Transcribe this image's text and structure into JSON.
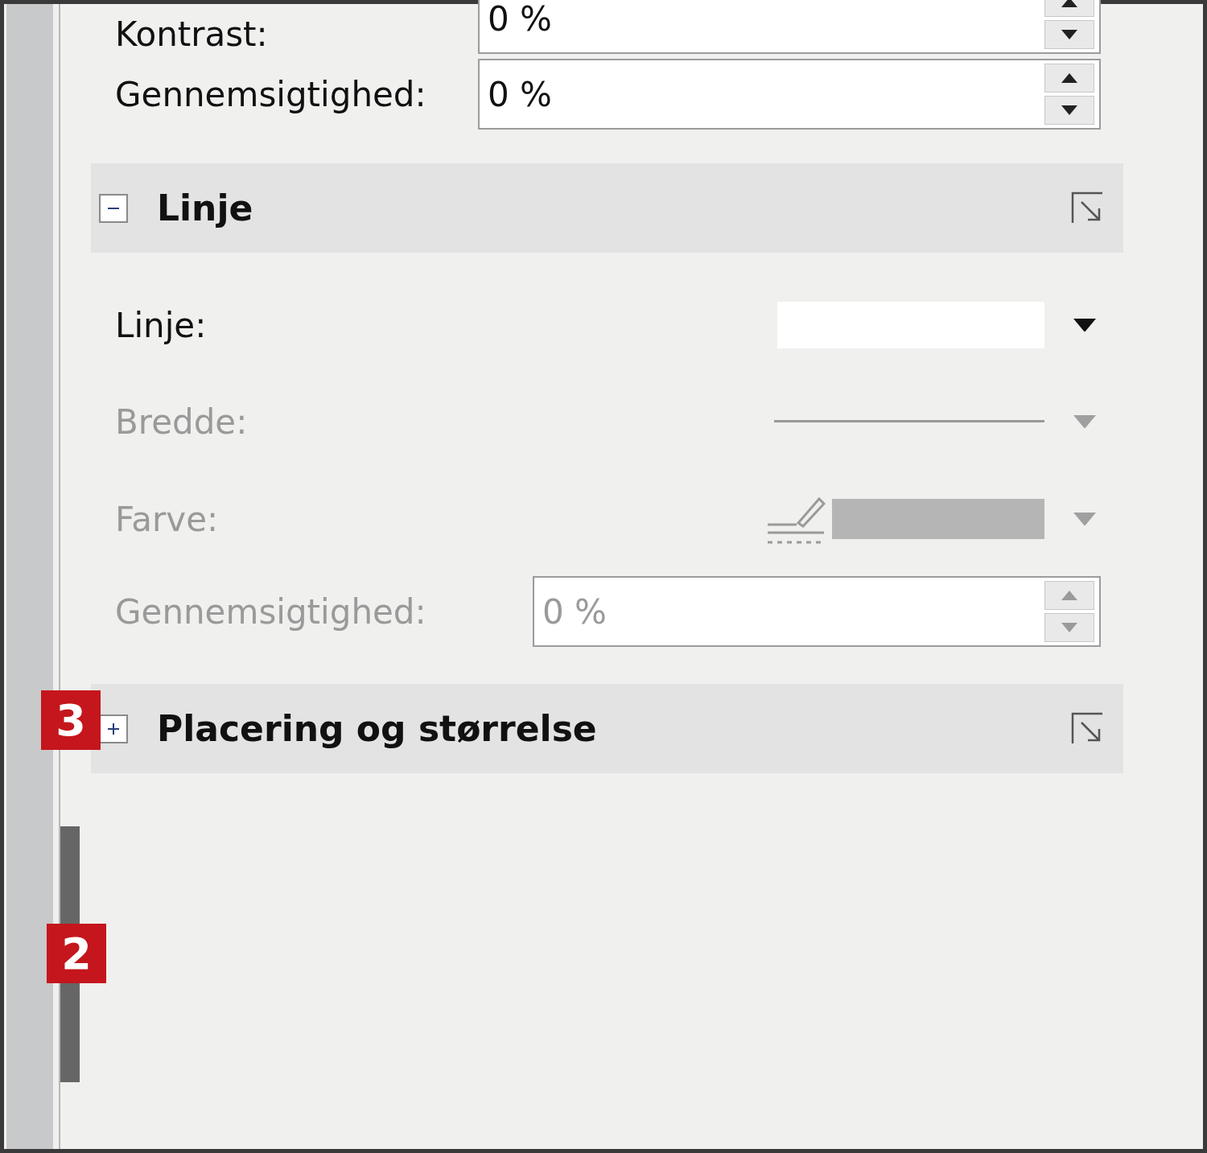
{
  "top_rows": [
    {
      "label": "Kontrast:",
      "value": "0 %",
      "disabled": false
    },
    {
      "label": "Gennemsigtighed:",
      "value": "0 %",
      "disabled": false
    }
  ],
  "sections": [
    {
      "title": "Linje",
      "expanded": true,
      "rows": [
        {
          "kind": "swatch",
          "label": "Linje:",
          "disabled": false
        },
        {
          "kind": "line",
          "label": "Bredde:",
          "disabled": true
        },
        {
          "kind": "color",
          "label": "Farve:",
          "disabled": true
        },
        {
          "kind": "spin",
          "label": "Gennemsigtighed:",
          "value": "0 %",
          "disabled": true
        }
      ]
    },
    {
      "title": "Placering og størrelse",
      "expanded": false,
      "callout": "3"
    }
  ],
  "handle_callout": "2"
}
